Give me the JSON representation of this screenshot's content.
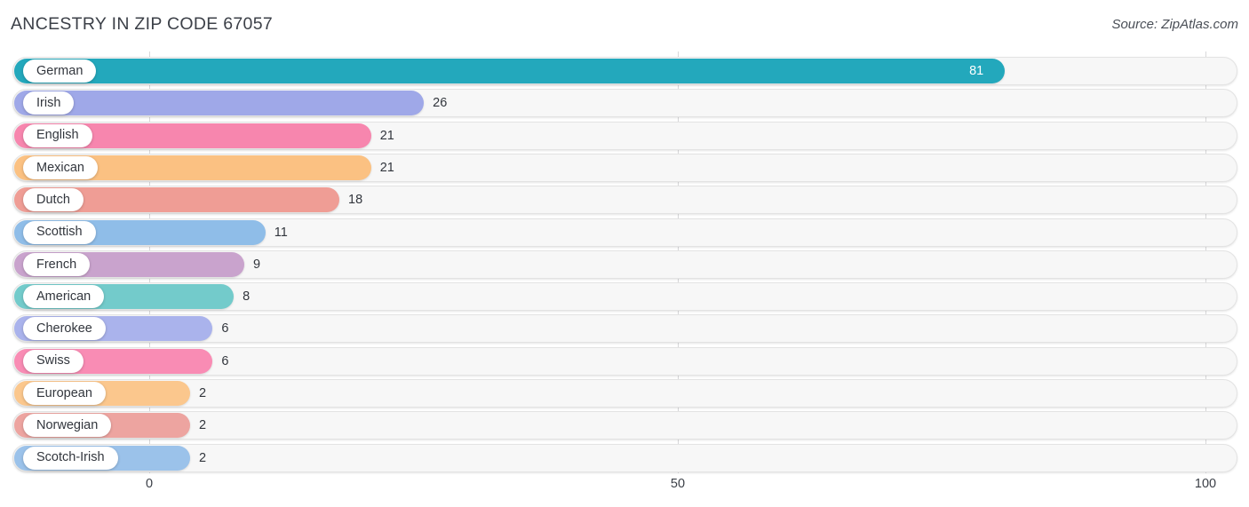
{
  "header": {
    "title": "ANCESTRY IN ZIP CODE 67057",
    "source": "Source: ZipAtlas.com"
  },
  "axis": {
    "ticks": [
      {
        "label": "0",
        "value": 0
      },
      {
        "label": "50",
        "value": 50
      },
      {
        "label": "100",
        "value": 100
      }
    ]
  },
  "chart_data": {
    "type": "bar",
    "orientation": "horizontal",
    "title": "ANCESTRY IN ZIP CODE 67057",
    "subtitle": "Source: ZipAtlas.com",
    "xlabel": "",
    "ylabel": "",
    "xlim": [
      0,
      100
    ],
    "grid": true,
    "legend": false,
    "categories": [
      "German",
      "Irish",
      "English",
      "Mexican",
      "Dutch",
      "Scottish",
      "French",
      "American",
      "Cherokee",
      "Swiss",
      "European",
      "Norwegian",
      "Scotch-Irish"
    ],
    "values": [
      81,
      26,
      21,
      21,
      18,
      11,
      9,
      8,
      6,
      6,
      2,
      2,
      2
    ],
    "colors": [
      "#23a8bc",
      "#9fa8e8",
      "#f786ae",
      "#fbc182",
      "#ef9d95",
      "#8fbde8",
      "#c9a3cd",
      "#73cbcb",
      "#aab3ec",
      "#f98cb4",
      "#fbc78d",
      "#eda4a0",
      "#9bc2ea"
    ],
    "bars": [
      {
        "category": "German",
        "value": 81,
        "label": "81",
        "color": "#23a8bc",
        "label_inside": true
      },
      {
        "category": "Irish",
        "value": 26,
        "label": "26",
        "color": "#9fa8e8",
        "label_inside": false
      },
      {
        "category": "English",
        "value": 21,
        "label": "21",
        "color": "#f786ae",
        "label_inside": false
      },
      {
        "category": "Mexican",
        "value": 21,
        "label": "21",
        "color": "#fbc182",
        "label_inside": false
      },
      {
        "category": "Dutch",
        "value": 18,
        "label": "18",
        "color": "#ef9d95",
        "label_inside": false
      },
      {
        "category": "Scottish",
        "value": 11,
        "label": "11",
        "color": "#8fbde8",
        "label_inside": false
      },
      {
        "category": "French",
        "value": 9,
        "label": "9",
        "color": "#c9a3cd",
        "label_inside": false
      },
      {
        "category": "American",
        "value": 8,
        "label": "8",
        "color": "#73cbcb",
        "label_inside": false
      },
      {
        "category": "Cherokee",
        "value": 6,
        "label": "6",
        "color": "#aab3ec",
        "label_inside": false
      },
      {
        "category": "Swiss",
        "value": 6,
        "label": "6",
        "color": "#f98cb4",
        "label_inside": false
      },
      {
        "category": "European",
        "value": 2,
        "label": "2",
        "color": "#fbc78d",
        "label_inside": false
      },
      {
        "category": "Norwegian",
        "value": 2,
        "label": "2",
        "color": "#eda4a0",
        "label_inside": false
      },
      {
        "category": "Scotch-Irish",
        "value": 2,
        "label": "2",
        "color": "#9bc2ea",
        "label_inside": false
      }
    ]
  }
}
